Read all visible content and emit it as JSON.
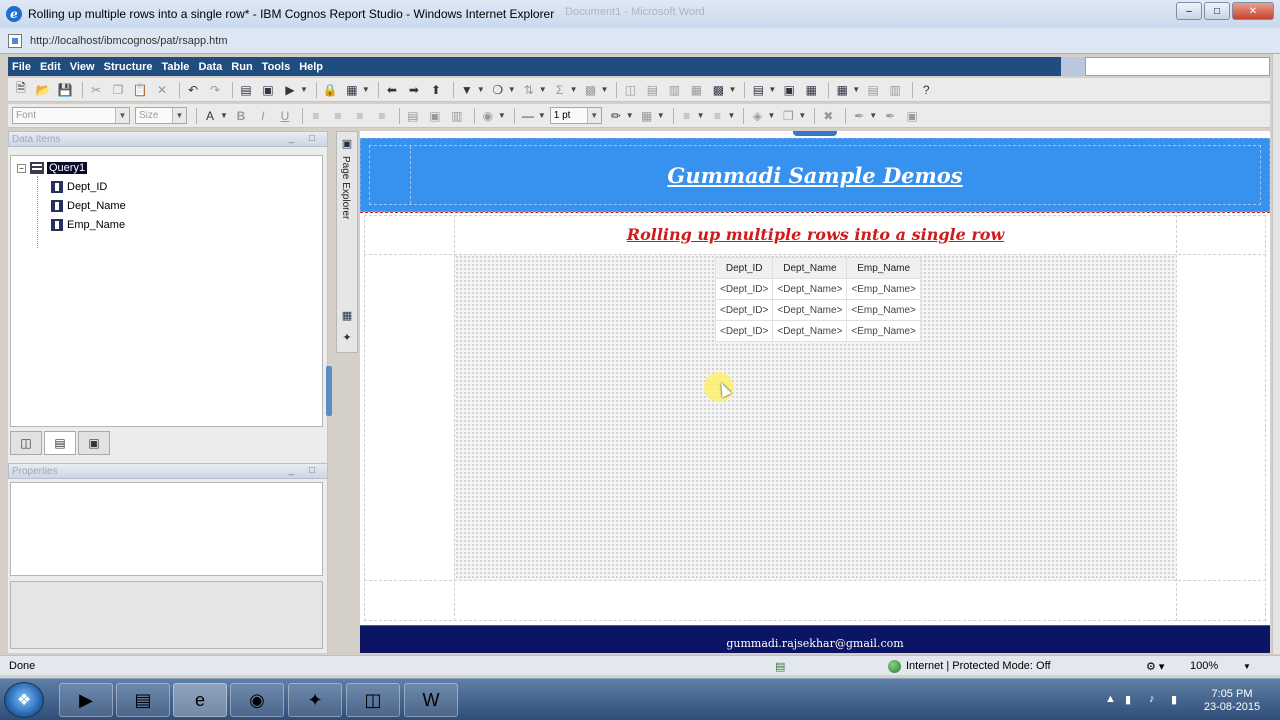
{
  "window": {
    "title": "Rolling up multiple rows into a single row* - IBM Cognos Report Studio - Windows Internet Explorer",
    "ghost_title": "Document1 - Microsoft Word"
  },
  "address": {
    "url": "http://localhost/ibmcognos/pat/rsapp.htm"
  },
  "menu": [
    "File",
    "Edit",
    "View",
    "Structure",
    "Table",
    "Data",
    "Run",
    "Tools",
    "Help"
  ],
  "format_toolbar": {
    "font_placeholder": "Font",
    "size_placeholder": "Size",
    "line_width": "1 pt"
  },
  "data_items": {
    "header": "Data Items",
    "query": "Query1",
    "fields": [
      "Dept_ID",
      "Dept_Name",
      "Emp_Name"
    ]
  },
  "properties": {
    "header": "Properties"
  },
  "explorer": {
    "label": "Page Explorer"
  },
  "report": {
    "banner_title": "Gummadi Sample Demos",
    "subtitle": "Rolling up multiple rows into a single row",
    "columns": [
      "Dept_ID",
      "Dept_Name",
      "Emp_Name"
    ],
    "rows": [
      [
        "<Dept_ID>",
        "<Dept_Name>",
        "<Emp_Name>"
      ],
      [
        "<Dept_ID>",
        "<Dept_Name>",
        "<Emp_Name>"
      ],
      [
        "<Dept_ID>",
        "<Dept_Name>",
        "<Emp_Name>"
      ]
    ],
    "footer": "gummadi.rajsekhar@gmail.com"
  },
  "status": {
    "left": "Done",
    "zone": "Internet | Protected Mode: Off",
    "zoom": "100%"
  },
  "taskbar": {
    "time": "7:05 PM",
    "date": "23-08-2015"
  },
  "colors": {
    "banner": "#3791ee",
    "footer": "#0c1466",
    "subtitle": "#d11a1a",
    "menubar": "#1f4d80"
  }
}
